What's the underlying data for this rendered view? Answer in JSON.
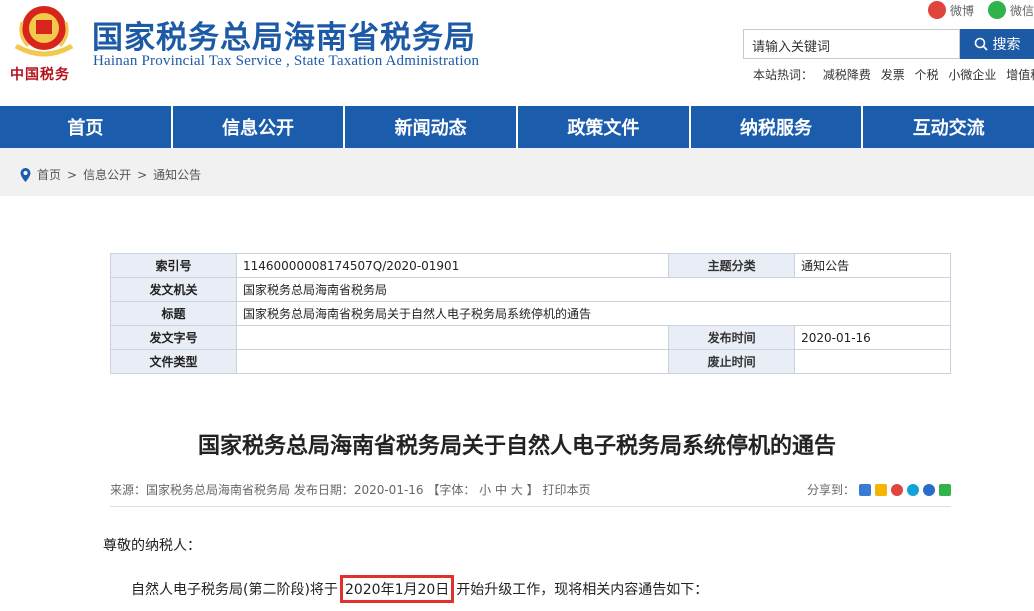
{
  "header": {
    "title": "国家税务总局海南省税务局",
    "subtitle": "Hainan Provincial Tax Service , State Taxation Administration",
    "emblem_text": "中国税务",
    "social": [
      {
        "label": "微博",
        "icon": "weibo-icon"
      },
      {
        "label": "微信",
        "icon": "wechat-icon"
      }
    ]
  },
  "search": {
    "placeholder": "请输入关键词",
    "button": "搜索",
    "hot_label": "本站热词：",
    "hot_words": [
      "减税降费",
      "发票",
      "个税",
      "小微企业",
      "增值税"
    ]
  },
  "nav": [
    "首页",
    "信息公开",
    "新闻动态",
    "政策文件",
    "纳税服务",
    "互动交流"
  ],
  "breadcrumb": [
    "首页",
    ">",
    "信息公开",
    ">",
    "通知公告"
  ],
  "info": {
    "index_label": "索引号",
    "index_value": "11460000008174507Q/2020-01901",
    "topic_label": "主题分类",
    "topic_value": "通知公告",
    "issuer_label": "发文机关",
    "issuer_value": "国家税务总局海南省税务局",
    "title_label": "标题",
    "title_value": "国家税务总局海南省税务局关于自然人电子税务局系统停机的通告",
    "docno_label": "发文字号",
    "docno_value": "",
    "pubdate_label": "发布时间",
    "pubdate_value": "2020-01-16",
    "type_label": "文件类型",
    "type_value": "",
    "expire_label": "废止时间",
    "expire_value": ""
  },
  "article": {
    "title": "国家税务总局海南省税务局关于自然人电子税务局系统停机的通告",
    "meta": "来源：国家税务总局海南省税务局   发布日期：2020-01-16   【字体： 小    中    大 】       打印本页",
    "share_label": "分享到：",
    "greeting": "尊敬的纳税人：",
    "para_before": "自然人电子税务局(第二阶段)将于",
    "para_highlight": "2020年1月20日",
    "para_after": "开始升级工作，现将相关内容通告如下："
  },
  "colors": {
    "brand_blue": "#1c5cac",
    "highlight_red": "#e2312c"
  }
}
